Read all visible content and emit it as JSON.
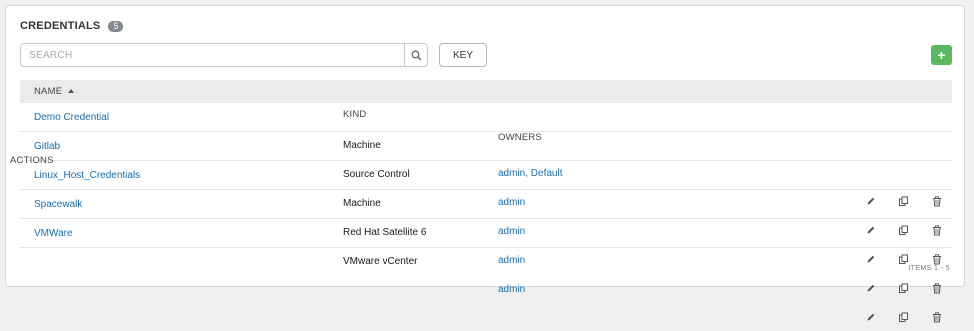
{
  "header": {
    "title": "CREDENTIALS",
    "count": "5"
  },
  "search": {
    "placeholder": "SEARCH"
  },
  "key_label": "KEY",
  "add_label": "+",
  "columns": {
    "name": "NAME",
    "kind": "KIND",
    "owners": "OWNERS",
    "actions": "ACTIONS"
  },
  "rows": [
    {
      "name": "Demo Credential",
      "kind": "Machine",
      "owners": "admin, Default"
    },
    {
      "name": "Gitlab",
      "kind": "Source Control",
      "owners": "admin"
    },
    {
      "name": "Linux_Host_Credentials",
      "kind": "Machine",
      "owners": "admin"
    },
    {
      "name": "Spacewalk",
      "kind": "Red Hat Satellite 6",
      "owners": "admin"
    },
    {
      "name": "VMWare",
      "kind": "VMware vCenter",
      "owners": "admin"
    }
  ],
  "footer": {
    "items": "ITEMS 1 - 5"
  },
  "colors": {
    "link": "#1a6db0",
    "add_button": "#5cb85c",
    "badge": "#848992",
    "header_row": "#ebebeb"
  },
  "icons": {
    "search": "search-icon",
    "sort": "sort-ascending-icon",
    "edit": "pencil-icon",
    "copy": "copy-icon",
    "delete": "trash-icon"
  }
}
